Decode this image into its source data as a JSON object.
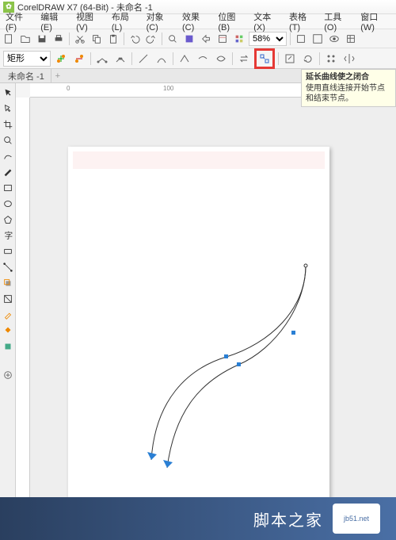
{
  "title": "CorelDRAW X7 (64-Bit) - 未命名 -1",
  "menu": [
    "文件(F)",
    "编辑(E)",
    "视图(V)",
    "布局(L)",
    "对象(C)",
    "效果(C)",
    "位图(B)",
    "文本(X)",
    "表格(T)",
    "工具(O)",
    "窗口(W)"
  ],
  "zoom": "58%",
  "shape_mode": "矩形",
  "tab": {
    "name": "未命名 -1",
    "add": "+"
  },
  "ruler": {
    "marks": [
      "0",
      "100"
    ]
  },
  "tooltip": {
    "title": "延长曲线使之闭合",
    "body": "使用直线连接开始节点和结束节点。"
  },
  "footer": {
    "text": "脚本之家",
    "url": "jb51.net"
  }
}
